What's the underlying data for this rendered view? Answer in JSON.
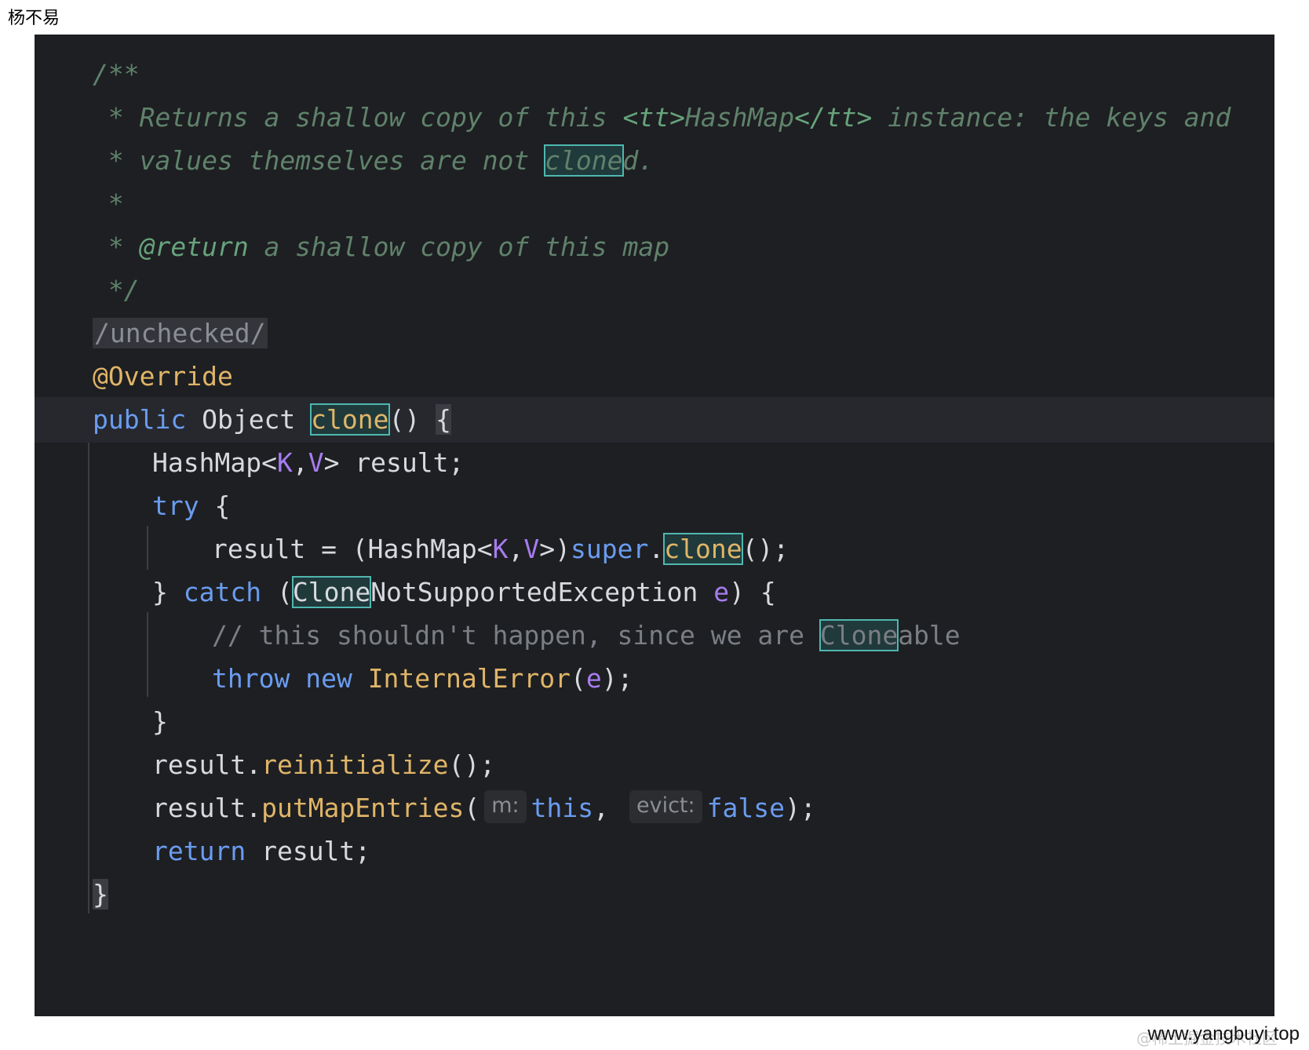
{
  "author_label": "杨不易",
  "watermark": "www.yangbuyi.top",
  "watermark_ghost": "@稀土掘金技术社区",
  "code": {
    "doc_open": "/**",
    "doc_line1_a": " * Returns a shallow copy of this ",
    "doc_line1_tt_open": "<tt>",
    "doc_line1_tt_text": "HashMap",
    "doc_line1_tt_close": "</tt>",
    "doc_line1_b": " instance: the keys and",
    "doc_line2_a": " * values themselves are not ",
    "doc_line2_hl": "clone",
    "doc_line2_b": "d.",
    "doc_line3": " *",
    "doc_line4_star": " * ",
    "doc_line4_tag": "@return",
    "doc_line4_rest": " a shallow copy of this map",
    "doc_close": " */",
    "region": "/unchecked/",
    "annotation": "@Override",
    "sig_kw": "public",
    "sig_type": " Object ",
    "sig_name": "clone",
    "sig_rest": "() ",
    "sig_brace": "{",
    "l1_a": "HashMap<",
    "l1_k": "K",
    "l1_comma": ",",
    "l1_v": "V",
    "l1_b": "> result;",
    "l2_kw": "try",
    "l2_b": " {",
    "l3_a": "result = (HashMap<",
    "l3_k": "K",
    "l3_comma": ",",
    "l3_v": "V",
    "l3_b": ">)",
    "l3_super": "super",
    "l3_dot": ".",
    "l3_clone": "clone",
    "l3_end": "();",
    "l4_a": "} ",
    "l4_kw": "catch",
    "l4_paren": " (",
    "l4_hl": "Clone",
    "l4_type": "NotSupportedException ",
    "l4_param": "e",
    "l4_end": ") {",
    "l5_cmt_a": "// this shouldn't happen, since we are ",
    "l5_hl": "Clone",
    "l5_cmt_b": "able",
    "l6_throw": "throw",
    "l6_new": " new ",
    "l6_cls": "InternalError",
    "l6_paren": "(",
    "l6_param": "e",
    "l6_end": ");",
    "l7": "}",
    "l8_a": "result.",
    "l8_fn": "reinitialize",
    "l8_end": "();",
    "l9_a": "result.",
    "l9_fn": "putMapEntries",
    "l9_paren": "(",
    "l9_hint_m": "m:",
    "l9_this": "this",
    "l9_comma": ",",
    "l9_hint_evict": "evict:",
    "l9_false": "false",
    "l9_end": ");",
    "l10_kw": "return",
    "l10_rest": " result;",
    "close_brace": "}"
  },
  "colors": {
    "editor_bg": "#1e1f22",
    "keyword": "#6a9cf0",
    "function": "#e0b568",
    "type_param": "#a77cf0",
    "comment": "#7a7e85",
    "doc_comment": "#5f826b",
    "highlight_border": "#4fb7b0"
  }
}
